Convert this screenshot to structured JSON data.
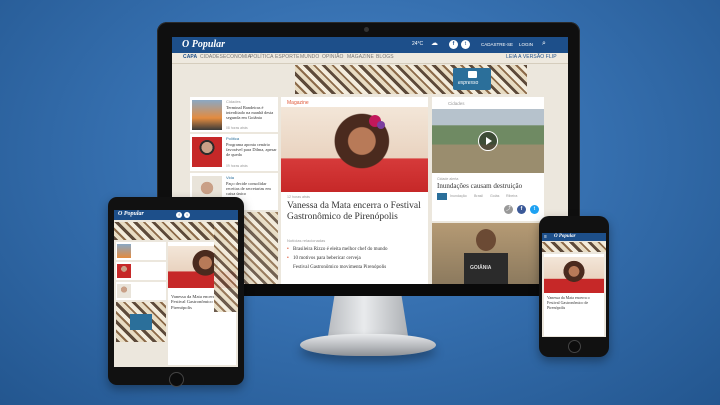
{
  "site": {
    "logo": "O Popular",
    "search_icon": "search-icon",
    "social": [
      "facebook-icon",
      "twitter-icon"
    ],
    "top_links": [
      "CADASTRE-SE",
      "LOGIN"
    ],
    "weather": "24°C"
  },
  "nav": [
    "CAPA",
    "CIDADES",
    "ECONOMIA",
    "POLÍTICA",
    "ESPORTE",
    "MUNDO",
    "OPINIÃO",
    "MAGAZINE",
    "BLOGS"
  ],
  "print_version": "LEIA A VERSÃO FLIP",
  "expresso_label": "expresso",
  "left_news": [
    {
      "section": "Cidades",
      "title": "Terminal Bandeiras é interditado na manhã desta segunda em Goiânia",
      "time": "08 horas atrás"
    },
    {
      "section": "Política",
      "title": "Programa aponta cenário favorável para Dilma, apesar de queda",
      "time": "09 horas atrás"
    },
    {
      "section": "Vida",
      "title": "Paço decide consolidar receitas de secretarias em caixa único",
      "time": "10 horas atrás"
    }
  ],
  "main_story": {
    "section": "Magazine",
    "date": "12 horas atrás",
    "title": "Vanessa da Mata encerra o Festival Gastronômico de Pirenópolis",
    "related_label": "Notícias relacionadas",
    "related": [
      "Brasileira Rizzo é eleita melhor chef do mundo",
      "10 motivos para bebericar cerveja",
      "Festival Gastronômico movimenta Pirenópolis"
    ]
  },
  "right_story": {
    "section": "Cidades",
    "time": "Cidade alerta",
    "title": "Inundações causam destruição",
    "tags": [
      "Inundação",
      "Brasil",
      "Goiás",
      "Ribeira"
    ]
  },
  "right_bottom_shirt": "GOIÂNIA",
  "tablet_main_title": "Vanessa da Mata encerra o Festival Gastronômico de Pirenópolis",
  "phone_main_title": "Vanessa da Mata encerra o Festival Gastronômico de Pirenópolis",
  "colors": {
    "brand": "#1d4f8a",
    "accent": "#e05a3a",
    "expresso": "#2b6f9a"
  }
}
